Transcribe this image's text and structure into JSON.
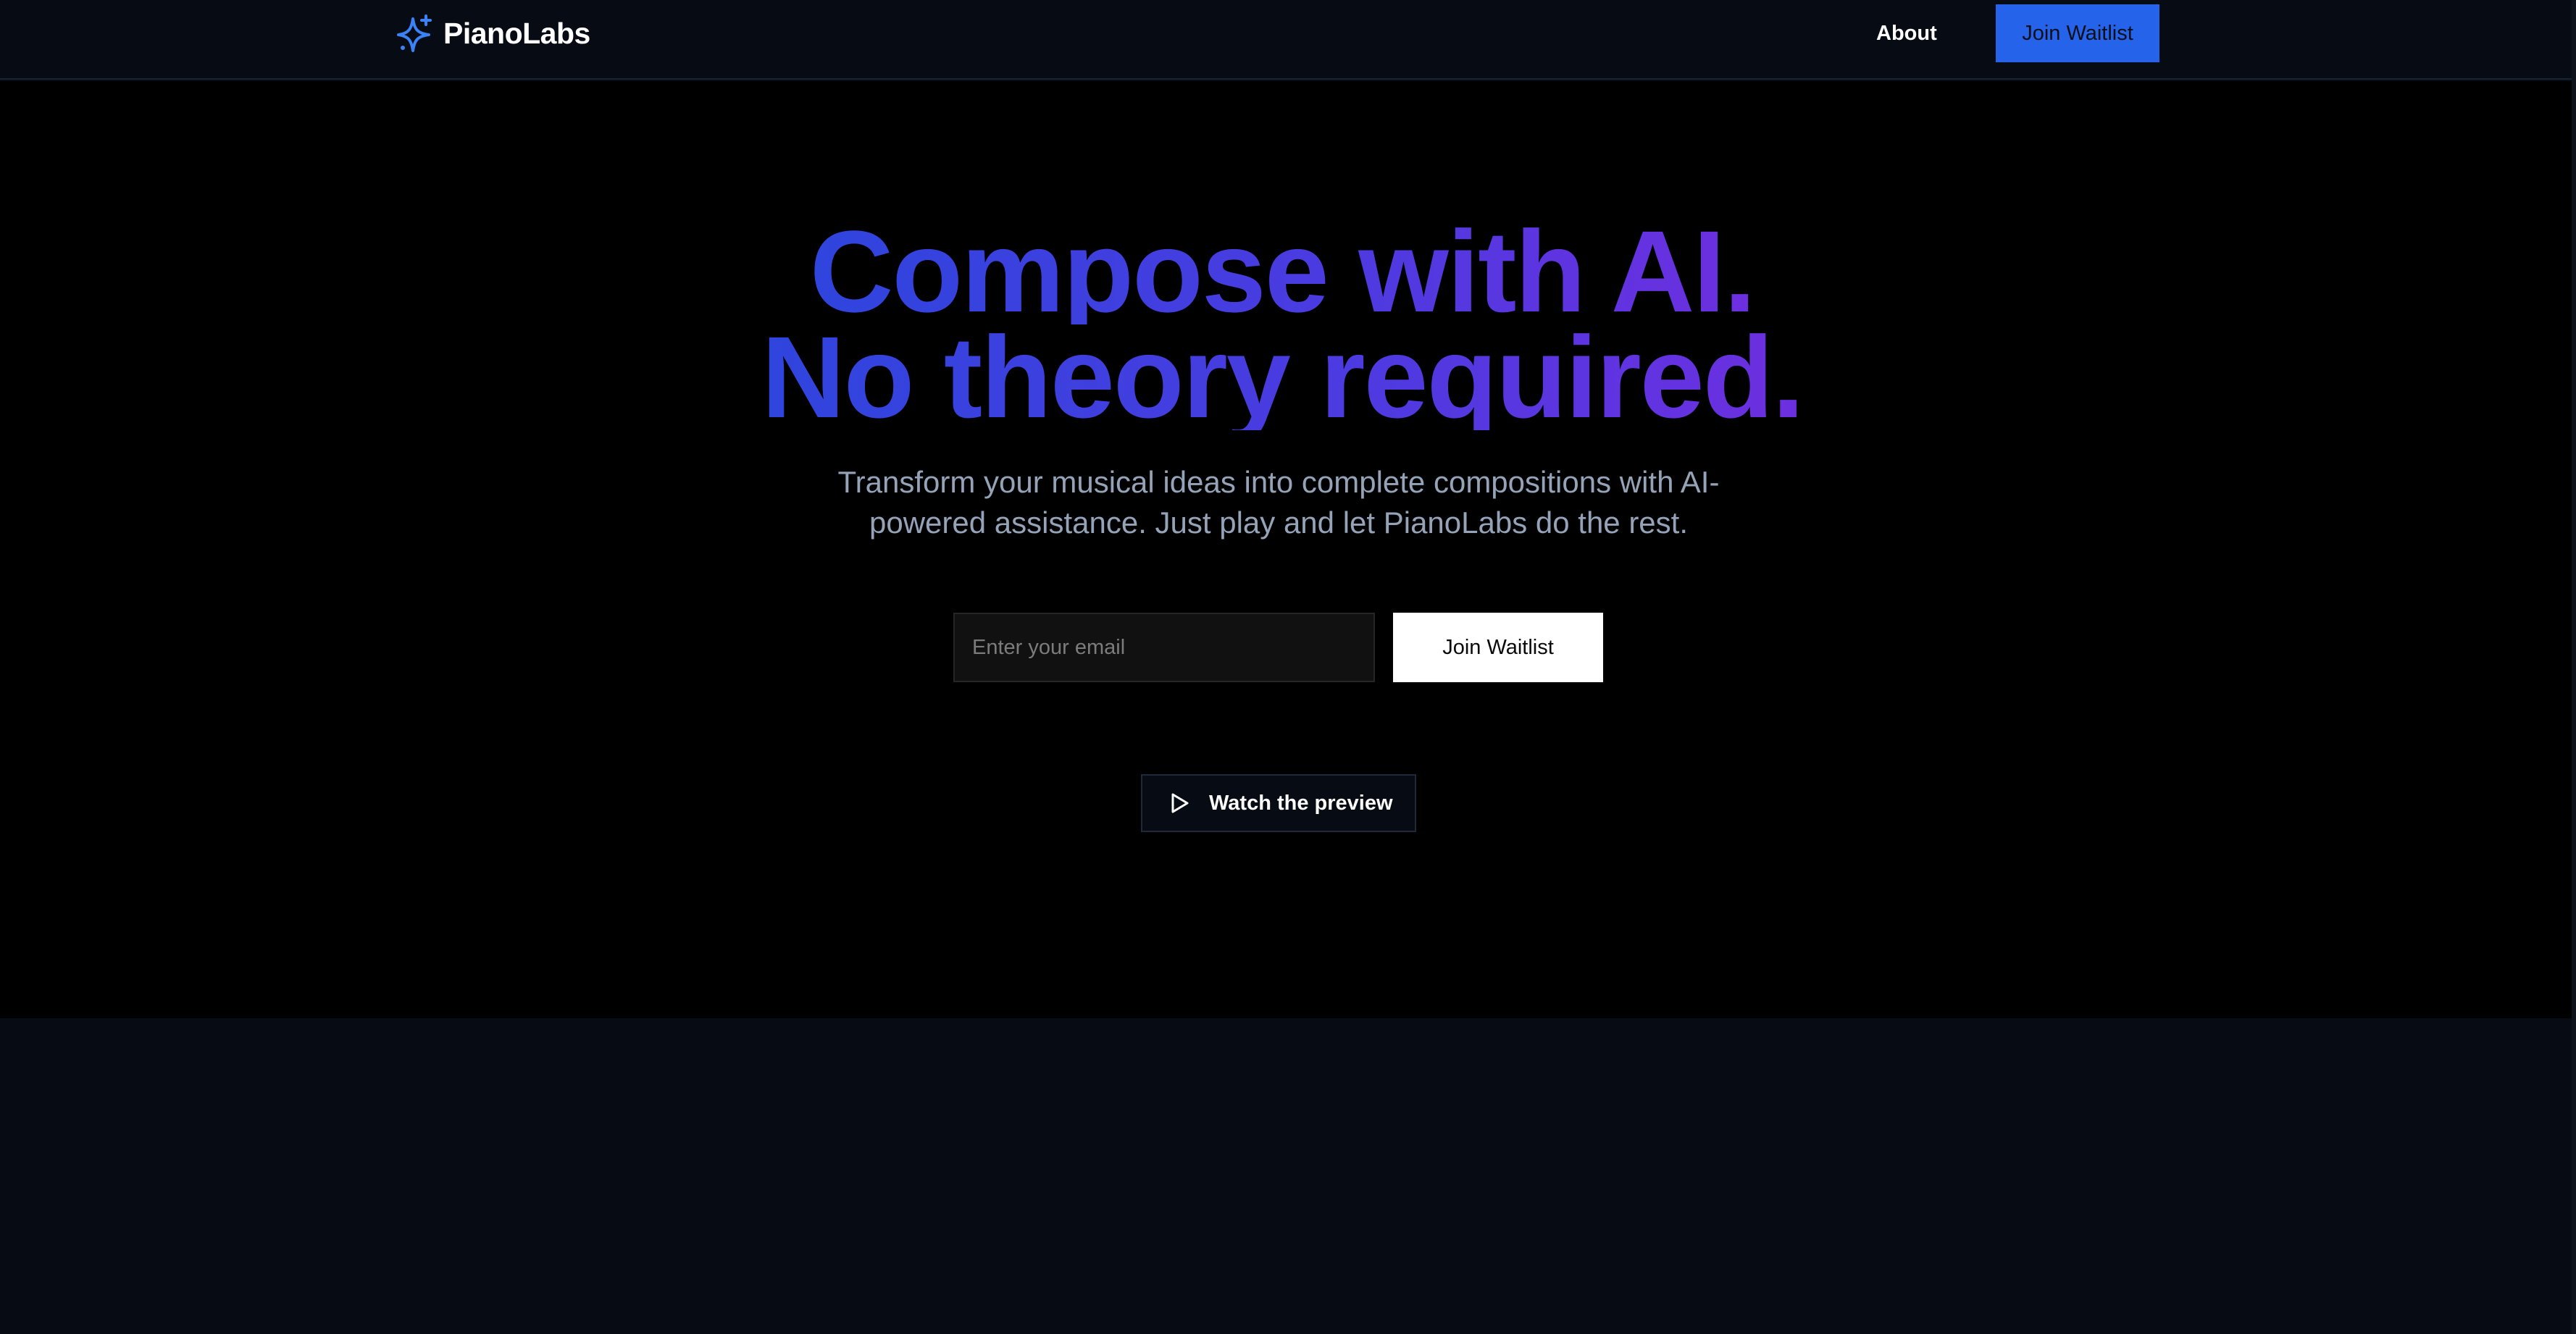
{
  "brand": {
    "name": "PianoLabs",
    "icon": "sparkles-icon",
    "accent_color": "#3b82f6"
  },
  "nav": {
    "about_label": "About",
    "join_label": "Join Waitlist"
  },
  "hero": {
    "headline_line1": "Compose with AI.",
    "headline_line2": "No theory required.",
    "subtitle": "Transform your musical ideas into complete compositions with AI-powered assistance. Just play and let PianoLabs do the rest.",
    "gradient_colors": [
      "#2f45dd",
      "#6d2fe0"
    ]
  },
  "signup": {
    "email_placeholder": "Enter your email",
    "email_value": "",
    "submit_label": "Join Waitlist"
  },
  "preview": {
    "label": "Watch the preview",
    "icon": "play-icon"
  },
  "colors": {
    "background": "#000000",
    "surface": "#070b13",
    "primary_button": "#2563eb",
    "subtitle_text": "#94a3b8"
  }
}
